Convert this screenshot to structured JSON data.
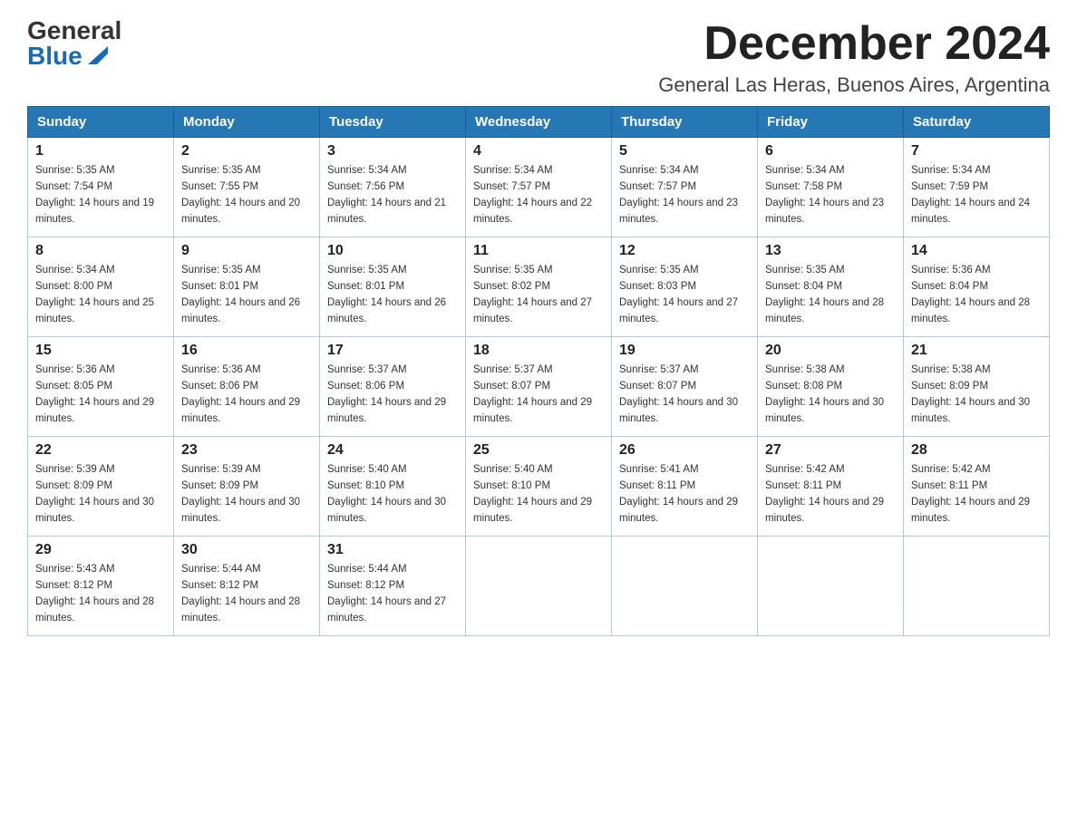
{
  "logo": {
    "general": "General",
    "blue": "Blue"
  },
  "header": {
    "month_title": "December 2024",
    "location": "General Las Heras, Buenos Aires, Argentina"
  },
  "weekdays": [
    "Sunday",
    "Monday",
    "Tuesday",
    "Wednesday",
    "Thursday",
    "Friday",
    "Saturday"
  ],
  "weeks": [
    [
      {
        "day": "1",
        "sunrise": "5:35 AM",
        "sunset": "7:54 PM",
        "daylight": "14 hours and 19 minutes."
      },
      {
        "day": "2",
        "sunrise": "5:35 AM",
        "sunset": "7:55 PM",
        "daylight": "14 hours and 20 minutes."
      },
      {
        "day": "3",
        "sunrise": "5:34 AM",
        "sunset": "7:56 PM",
        "daylight": "14 hours and 21 minutes."
      },
      {
        "day": "4",
        "sunrise": "5:34 AM",
        "sunset": "7:57 PM",
        "daylight": "14 hours and 22 minutes."
      },
      {
        "day": "5",
        "sunrise": "5:34 AM",
        "sunset": "7:57 PM",
        "daylight": "14 hours and 23 minutes."
      },
      {
        "day": "6",
        "sunrise": "5:34 AM",
        "sunset": "7:58 PM",
        "daylight": "14 hours and 23 minutes."
      },
      {
        "day": "7",
        "sunrise": "5:34 AM",
        "sunset": "7:59 PM",
        "daylight": "14 hours and 24 minutes."
      }
    ],
    [
      {
        "day": "8",
        "sunrise": "5:34 AM",
        "sunset": "8:00 PM",
        "daylight": "14 hours and 25 minutes."
      },
      {
        "day": "9",
        "sunrise": "5:35 AM",
        "sunset": "8:01 PM",
        "daylight": "14 hours and 26 minutes."
      },
      {
        "day": "10",
        "sunrise": "5:35 AM",
        "sunset": "8:01 PM",
        "daylight": "14 hours and 26 minutes."
      },
      {
        "day": "11",
        "sunrise": "5:35 AM",
        "sunset": "8:02 PM",
        "daylight": "14 hours and 27 minutes."
      },
      {
        "day": "12",
        "sunrise": "5:35 AM",
        "sunset": "8:03 PM",
        "daylight": "14 hours and 27 minutes."
      },
      {
        "day": "13",
        "sunrise": "5:35 AM",
        "sunset": "8:04 PM",
        "daylight": "14 hours and 28 minutes."
      },
      {
        "day": "14",
        "sunrise": "5:36 AM",
        "sunset": "8:04 PM",
        "daylight": "14 hours and 28 minutes."
      }
    ],
    [
      {
        "day": "15",
        "sunrise": "5:36 AM",
        "sunset": "8:05 PM",
        "daylight": "14 hours and 29 minutes."
      },
      {
        "day": "16",
        "sunrise": "5:36 AM",
        "sunset": "8:06 PM",
        "daylight": "14 hours and 29 minutes."
      },
      {
        "day": "17",
        "sunrise": "5:37 AM",
        "sunset": "8:06 PM",
        "daylight": "14 hours and 29 minutes."
      },
      {
        "day": "18",
        "sunrise": "5:37 AM",
        "sunset": "8:07 PM",
        "daylight": "14 hours and 29 minutes."
      },
      {
        "day": "19",
        "sunrise": "5:37 AM",
        "sunset": "8:07 PM",
        "daylight": "14 hours and 30 minutes."
      },
      {
        "day": "20",
        "sunrise": "5:38 AM",
        "sunset": "8:08 PM",
        "daylight": "14 hours and 30 minutes."
      },
      {
        "day": "21",
        "sunrise": "5:38 AM",
        "sunset": "8:09 PM",
        "daylight": "14 hours and 30 minutes."
      }
    ],
    [
      {
        "day": "22",
        "sunrise": "5:39 AM",
        "sunset": "8:09 PM",
        "daylight": "14 hours and 30 minutes."
      },
      {
        "day": "23",
        "sunrise": "5:39 AM",
        "sunset": "8:09 PM",
        "daylight": "14 hours and 30 minutes."
      },
      {
        "day": "24",
        "sunrise": "5:40 AM",
        "sunset": "8:10 PM",
        "daylight": "14 hours and 30 minutes."
      },
      {
        "day": "25",
        "sunrise": "5:40 AM",
        "sunset": "8:10 PM",
        "daylight": "14 hours and 29 minutes."
      },
      {
        "day": "26",
        "sunrise": "5:41 AM",
        "sunset": "8:11 PM",
        "daylight": "14 hours and 29 minutes."
      },
      {
        "day": "27",
        "sunrise": "5:42 AM",
        "sunset": "8:11 PM",
        "daylight": "14 hours and 29 minutes."
      },
      {
        "day": "28",
        "sunrise": "5:42 AM",
        "sunset": "8:11 PM",
        "daylight": "14 hours and 29 minutes."
      }
    ],
    [
      {
        "day": "29",
        "sunrise": "5:43 AM",
        "sunset": "8:12 PM",
        "daylight": "14 hours and 28 minutes."
      },
      {
        "day": "30",
        "sunrise": "5:44 AM",
        "sunset": "8:12 PM",
        "daylight": "14 hours and 28 minutes."
      },
      {
        "day": "31",
        "sunrise": "5:44 AM",
        "sunset": "8:12 PM",
        "daylight": "14 hours and 27 minutes."
      },
      null,
      null,
      null,
      null
    ]
  ]
}
